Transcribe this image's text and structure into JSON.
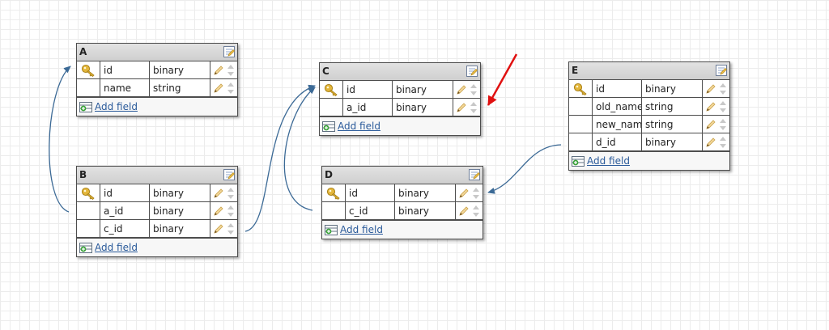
{
  "tables": [
    {
      "name": "A",
      "fields": [
        {
          "name": "id",
          "type": "binary",
          "key": true
        },
        {
          "name": "name",
          "type": "string",
          "key": false
        }
      ]
    },
    {
      "name": "B",
      "fields": [
        {
          "name": "id",
          "type": "binary",
          "key": true
        },
        {
          "name": "a_id",
          "type": "binary",
          "key": false
        },
        {
          "name": "c_id",
          "type": "binary",
          "key": false
        }
      ]
    },
    {
      "name": "C",
      "fields": [
        {
          "name": "id",
          "type": "binary",
          "key": true
        },
        {
          "name": "a_id",
          "type": "binary",
          "key": false
        }
      ]
    },
    {
      "name": "D",
      "fields": [
        {
          "name": "id",
          "type": "binary",
          "key": true
        },
        {
          "name": "c_id",
          "type": "binary",
          "key": false
        }
      ]
    },
    {
      "name": "E",
      "fields": [
        {
          "name": "id",
          "type": "binary",
          "key": true
        },
        {
          "name": "old_name",
          "type": "string",
          "key": false
        },
        {
          "name": "new_name",
          "type": "string",
          "key": false
        },
        {
          "name": "d_id",
          "type": "binary",
          "key": false
        }
      ]
    }
  ],
  "add_field_label": "Add field",
  "colors": {
    "connector": "#3c6a96",
    "annotation_arrow": "#e01010",
    "link": "#2a5a9a"
  },
  "icons": {
    "key": "key-icon",
    "edit": "edit-table-icon",
    "pencil": "pencil-icon",
    "reorder": "reorder-arrows-icon",
    "add": "add-field-icon"
  }
}
